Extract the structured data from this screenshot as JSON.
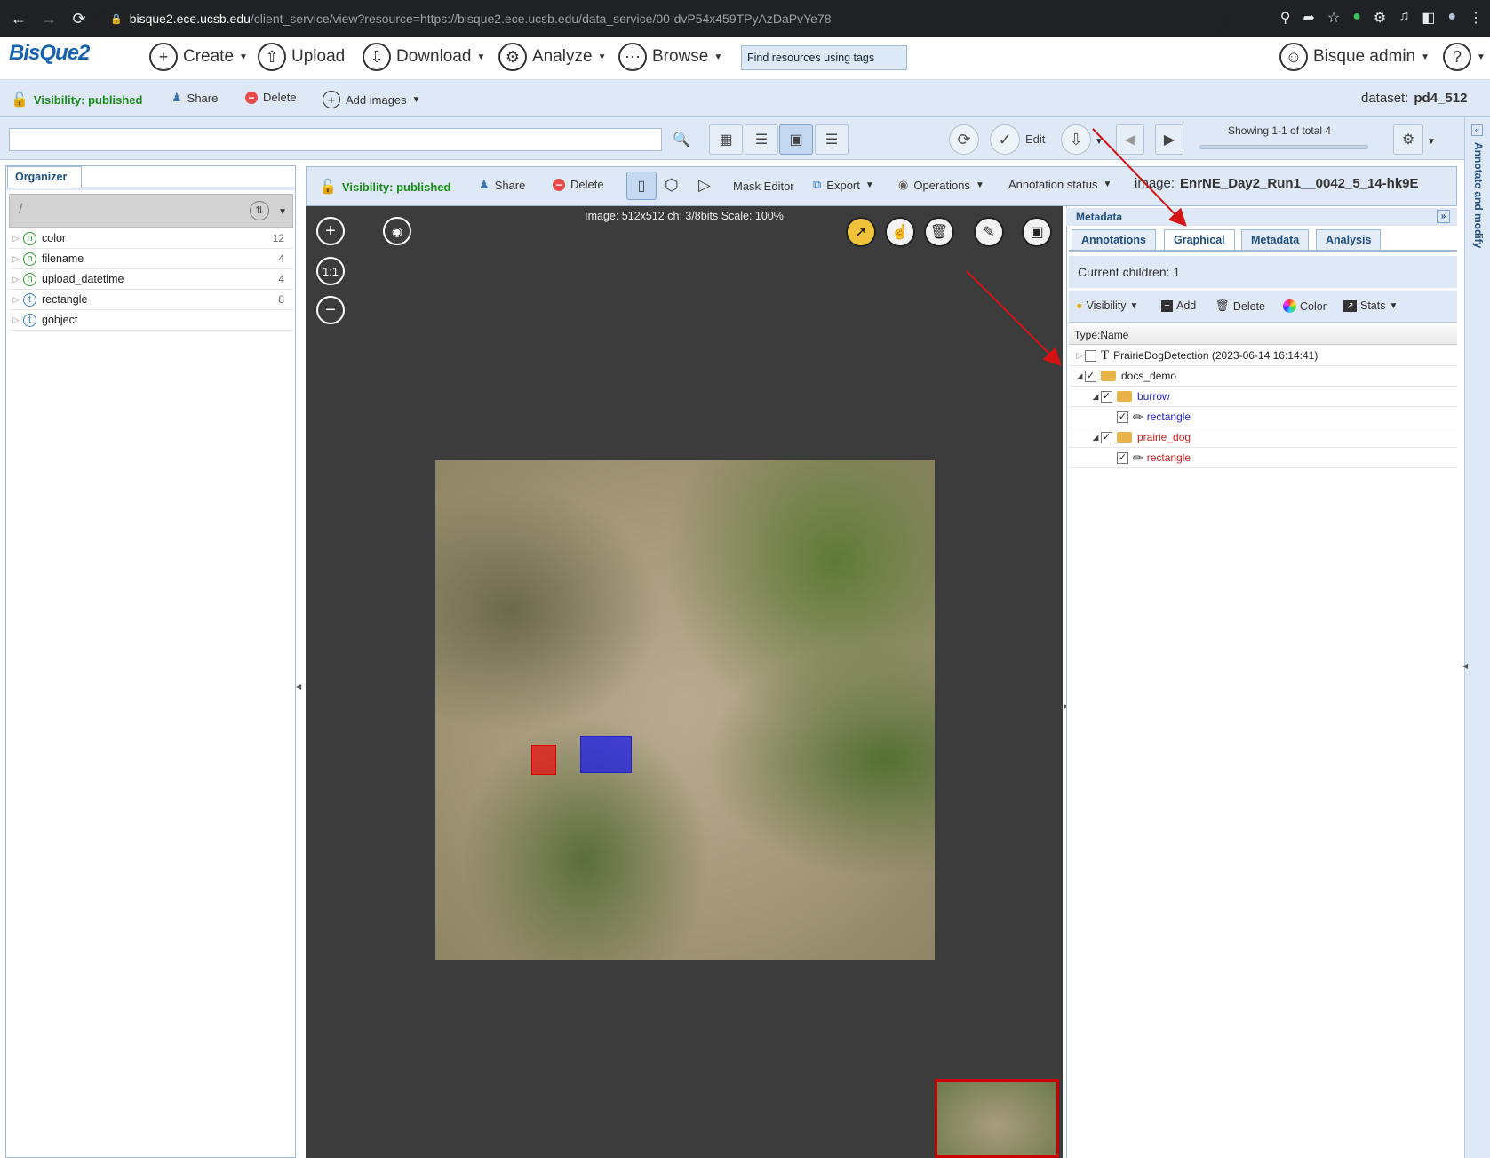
{
  "browser": {
    "url_host": "bisque2.ece.ucsb.edu",
    "url_path": "/client_service/view?resource=https://bisque2.ece.ucsb.edu/data_service/00-dvP54x459TPyAzDaPvYe78"
  },
  "app": {
    "logo": "BisQue2",
    "menu": {
      "create": "Create",
      "upload": "Upload",
      "download": "Download",
      "analyze": "Analyze",
      "browse": "Browse"
    },
    "tag_search_placeholder": "Find resources using tags",
    "user": "Bisque admin",
    "help": "?"
  },
  "dataset_toolbar": {
    "visibility": "Visibility: published",
    "share": "Share",
    "delete": "Delete",
    "add_images": "Add images",
    "dataset_label": "dataset:",
    "dataset_name": "pd4_512"
  },
  "browse_toolbar": {
    "edit": "Edit",
    "showing": "Showing 1-1 of total 4"
  },
  "organizer": {
    "tab": "Organizer",
    "path": "/",
    "rows": [
      {
        "type": "n",
        "name": "color",
        "count": "12"
      },
      {
        "type": "n",
        "name": "filename",
        "count": "4"
      },
      {
        "type": "n",
        "name": "upload_datetime",
        "count": "4"
      },
      {
        "type": "t",
        "name": "rectangle",
        "count": "8"
      },
      {
        "type": "t",
        "name": "gobject",
        "count": ""
      }
    ]
  },
  "viewer_toolbar": {
    "visibility": "Visibility: published",
    "share": "Share",
    "delete": "Delete",
    "mask_editor": "Mask Editor",
    "export": "Export",
    "operations": "Operations",
    "annotation_status": "Annotation status",
    "image_label": "image:",
    "image_name": "EnrNE_Day2_Run1__0042_5_14-hk9E"
  },
  "viewer": {
    "info_prefix": "Image: ",
    "info_dims": "512x512",
    "info_rest": " ch: 3/8bits Scale: 100%",
    "ratio_btn": "1:1"
  },
  "metadata": {
    "title": "Metadata",
    "tabs": [
      "Annotations",
      "Graphical",
      "Metadata",
      "Analysis"
    ],
    "active_tab": "Graphical",
    "current_children": "Current children: 1",
    "toolbar": {
      "visibility": "Visibility",
      "add": "Add",
      "delete": "Delete",
      "color": "Color",
      "stats": "Stats"
    },
    "column": "Type:Name",
    "tree": [
      {
        "label": "PrairieDogDetection (2023-06-14 16:14:41)",
        "color": "#222222"
      },
      {
        "label": "docs_demo",
        "color": "#222222"
      },
      {
        "label": "burrow",
        "color": "#2323d0"
      },
      {
        "label": "rectangle",
        "color": "#2323d0"
      },
      {
        "label": "prairie_dog",
        "color": "#d02020"
      },
      {
        "label": "rectangle",
        "color": "#d02020"
      }
    ]
  },
  "side_panel": "Annotate and modify"
}
